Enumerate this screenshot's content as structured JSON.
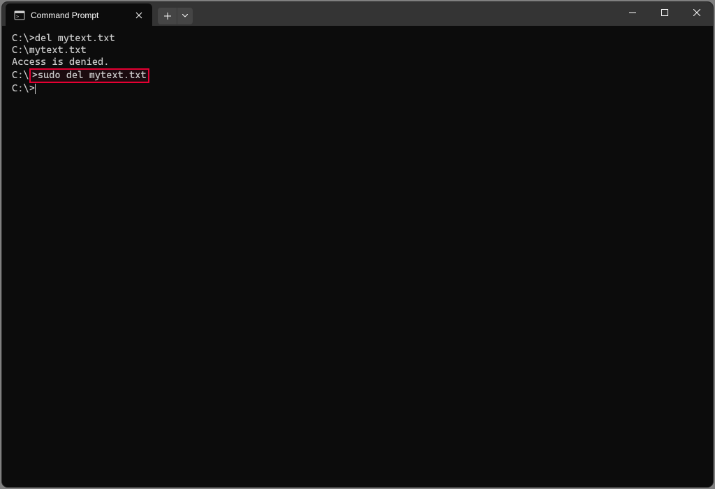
{
  "window": {
    "tab_title": "Command Prompt"
  },
  "terminal": {
    "lines": [
      {
        "prompt": "C:\\>",
        "text": "del mytext.txt"
      },
      {
        "prompt": "",
        "text": "C:\\mytext.txt"
      },
      {
        "prompt": "",
        "text": "Access is denied."
      },
      {
        "prompt": "",
        "text": ""
      },
      {
        "prompt": "C:\\>",
        "text": "sudo del mytext.txt",
        "highlight": true
      },
      {
        "prompt": "",
        "text": ""
      },
      {
        "prompt": "C:\\>",
        "text": "",
        "cursor": true
      }
    ]
  },
  "highlight_color": "#e60033"
}
